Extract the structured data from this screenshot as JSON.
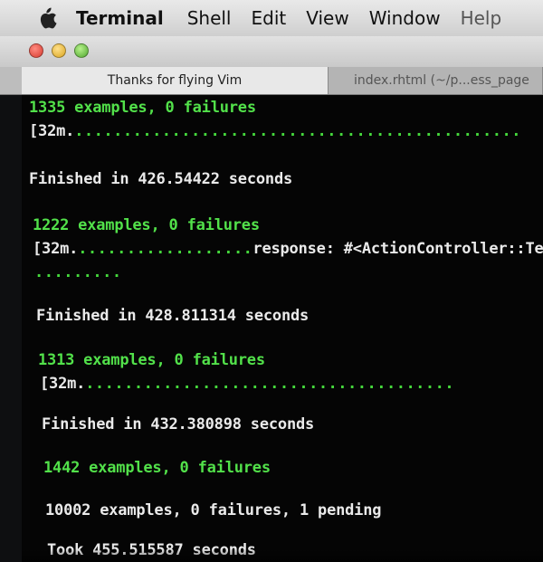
{
  "menubar": {
    "app": "Terminal",
    "items": [
      "Shell",
      "Edit",
      "View",
      "Window",
      "Help"
    ]
  },
  "tabs": [
    {
      "label": "Thanks for flying Vim",
      "active": true
    },
    {
      "label": "index.rhtml (~/p...ess_page",
      "active": false
    }
  ],
  "terminal": {
    "line1": "1335 examples, 0 failures",
    "line2_esc": "[32m.",
    "line2_dots": "..............................................",
    "line3": "Finished in 426.54422 seconds",
    "line4": "1222 examples, 0 failures",
    "line5_esc": "[32m.",
    "line5_dots": "..................",
    "line5_text": "response: #<ActionController::Te",
    "line6_dots": ".........",
    "line7": "Finished in 428.811314 seconds",
    "line8": "1313 examples, 0 failures",
    "line9_esc": "[32m.",
    "line9_dots": "......................................",
    "line10": "Finished in 432.380898 seconds",
    "line11": "1442 examples, 0 failures",
    "line12": "10002 examples, 0 failures, 1 pending",
    "line13": "Took 455.515587 seconds"
  },
  "colors": {
    "pass": "#52e14a",
    "text": "#eaeaea",
    "background": "#050505"
  }
}
